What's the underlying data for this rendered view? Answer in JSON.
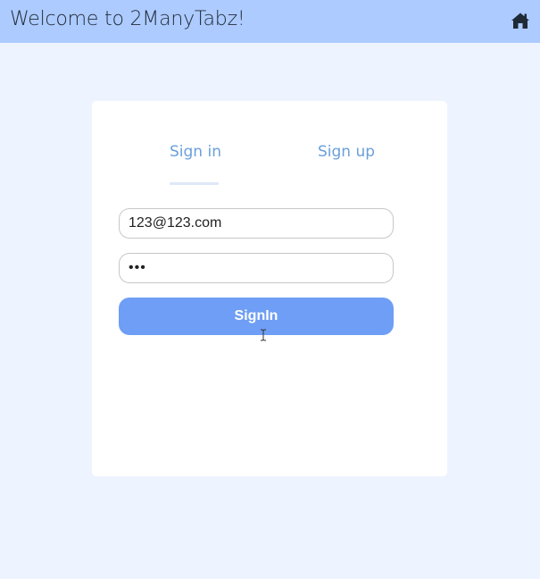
{
  "header": {
    "title": "Welcome to 2ManyTabz!",
    "home_icon": "home-icon",
    "background": "#adcbff"
  },
  "auth": {
    "tabs": [
      {
        "label": "Sign in",
        "active": true
      },
      {
        "label": "Sign up",
        "active": false
      }
    ],
    "email_value": "123@123.com",
    "password_value": "•••",
    "submit_label": "SignIn",
    "accent": "#6e9ef5",
    "tab_color": "#6a9fda"
  },
  "page": {
    "background": "#eef4ff"
  }
}
